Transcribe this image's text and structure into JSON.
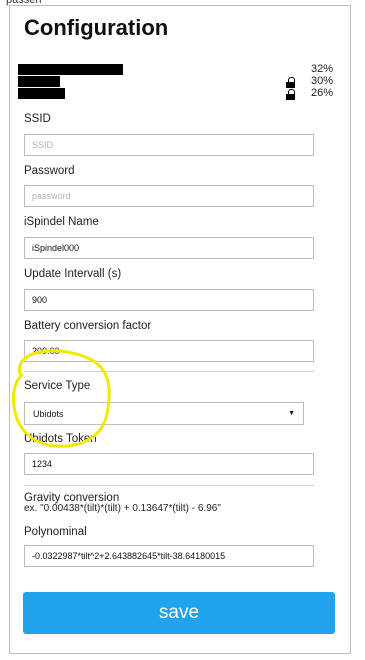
{
  "window": {
    "title": "Configuration"
  },
  "top_cut_text": "passen",
  "networks": [
    {
      "strength": "32%",
      "secured": false
    },
    {
      "strength": "30%",
      "secured": true
    },
    {
      "strength": "26%",
      "secured": true
    }
  ],
  "form": {
    "ssid": {
      "label": "SSID",
      "value": "",
      "placeholder": "SSID"
    },
    "password": {
      "label": "Password",
      "value": "",
      "placeholder": "password"
    },
    "name": {
      "label": "iSpindel Name",
      "value": "iSpindel000",
      "placeholder": ""
    },
    "interval": {
      "label": "Update Intervall (s)",
      "value": "900",
      "placeholder": ""
    },
    "battery": {
      "label": "Battery conversion factor",
      "value": "200.00",
      "placeholder": ""
    },
    "service": {
      "label": "Service Type",
      "selected": "Ubidots"
    },
    "token": {
      "label": "Ubidots Token",
      "value": "1234",
      "placeholder": ""
    },
    "gravity": {
      "label": "Gravity conversion",
      "example": "ex. \"0.00438*(tilt)*(tilt) + 0.13647*(tilt) - 6.96\""
    },
    "polynomial": {
      "label": "Polynominal",
      "value": "-0.0322987*tilt^2+2.643882645*tilt-38.64180015",
      "placeholder": ""
    }
  },
  "save_button": {
    "label": "save"
  },
  "colors": {
    "accent": "#1fa3ec",
    "highlight": "#f2e800"
  }
}
